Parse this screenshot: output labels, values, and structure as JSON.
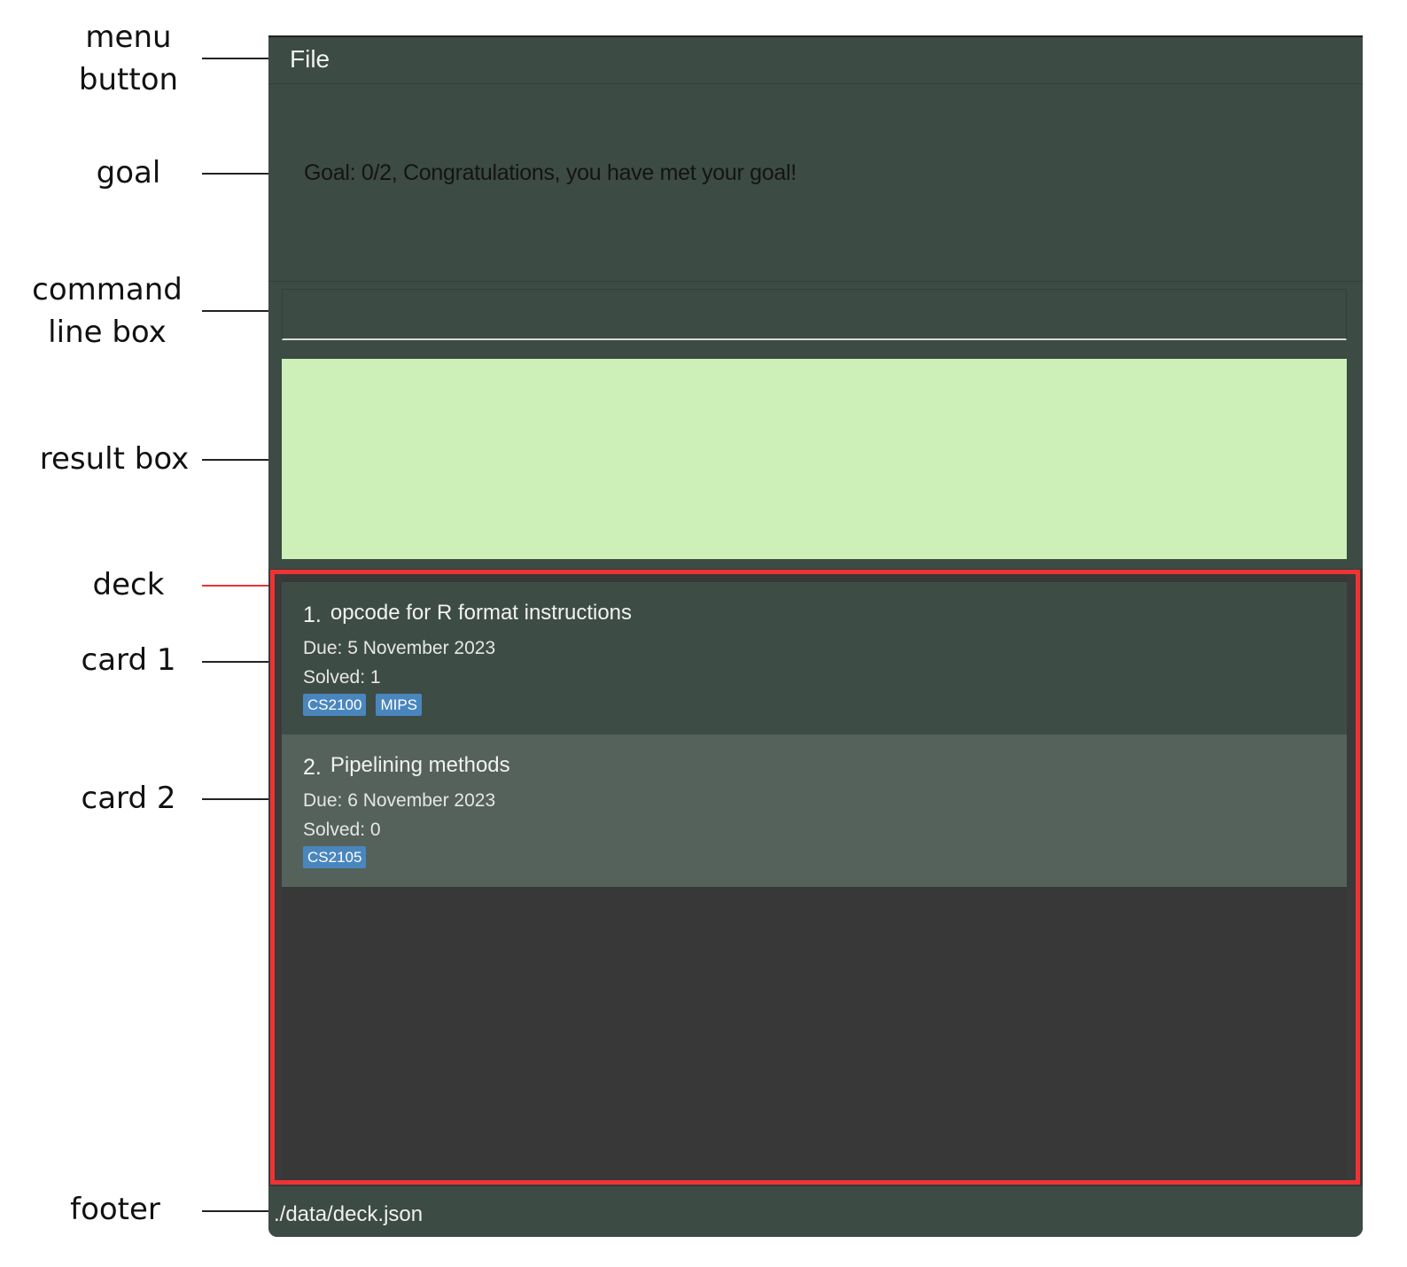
{
  "annotations": {
    "menu_button": "menu\nbutton",
    "goal": "goal",
    "command_line_box": "command\nline box",
    "result_box": "result box",
    "deck": "deck",
    "card_1": "card 1",
    "card_2": "card 2",
    "footer": "footer"
  },
  "app": {
    "menu": {
      "file_label": "File"
    },
    "goal_text": "Goal: 0/2, Congratulations, you have met your goal!",
    "command_input": {
      "value": "",
      "placeholder": ""
    },
    "result_text": "",
    "deck": {
      "cards": [
        {
          "index": "1.",
          "title": "opcode for R format instructions",
          "due": "Due: 5 November 2023",
          "solved": "Solved: 1",
          "tags": [
            "CS2100",
            "MIPS"
          ]
        },
        {
          "index": "2.",
          "title": "Pipelining methods",
          "due": "Due: 6 November 2023",
          "solved": "Solved: 0",
          "tags": [
            "CS2105"
          ]
        }
      ]
    },
    "footer_path": "./data/deck.json"
  },
  "colors": {
    "window_bg": "#3c4b44",
    "result_bg": "#ccf0b8",
    "deck_bg": "#383838",
    "card2_bg": "#55625b",
    "tag_bg": "#4a86be",
    "highlight": "#ee3333"
  }
}
